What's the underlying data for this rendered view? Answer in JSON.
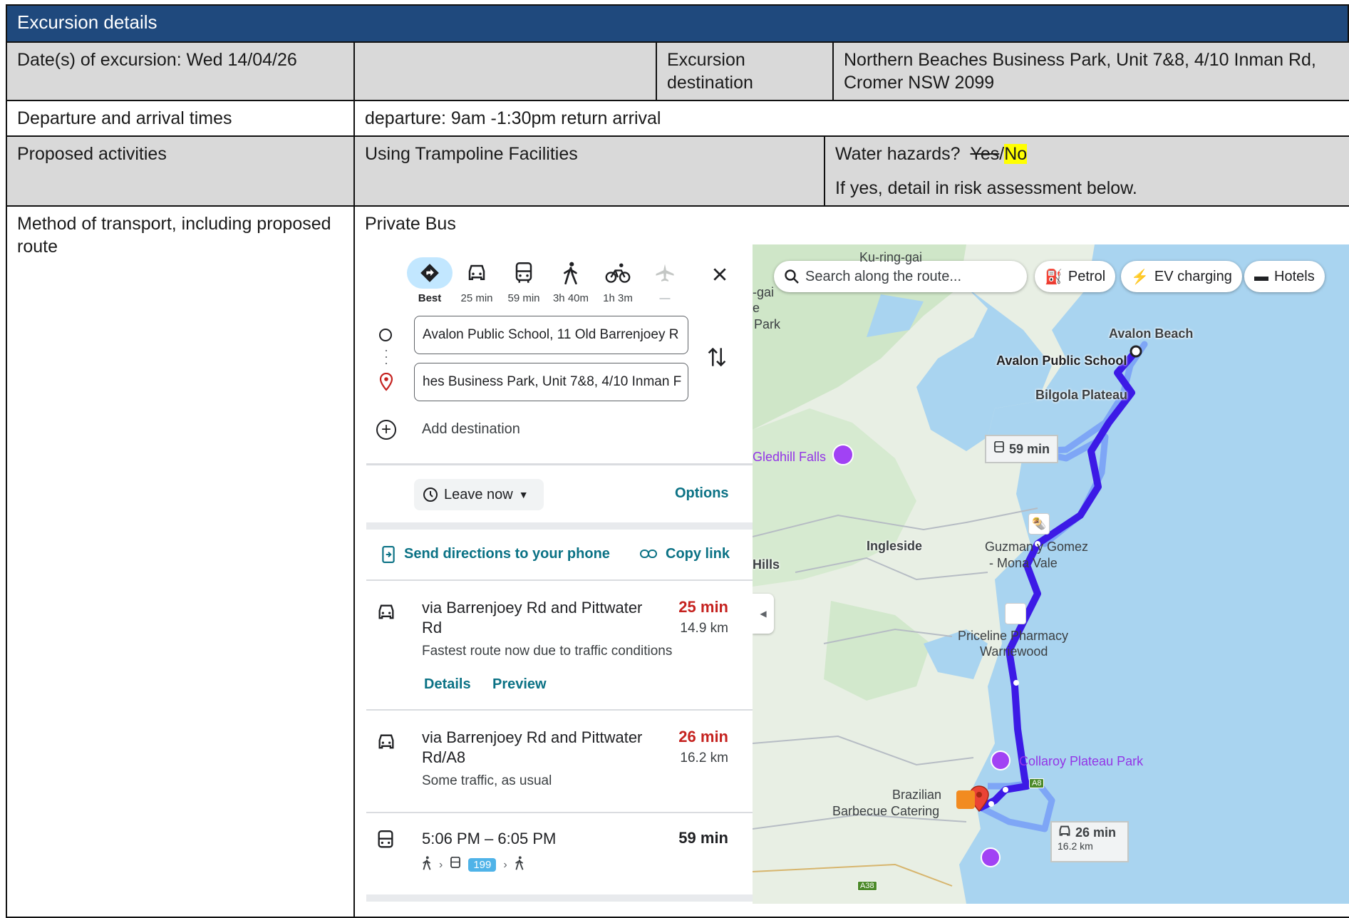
{
  "header": {
    "title": "Excursion details"
  },
  "rows": {
    "dates": {
      "label": "Date(s) of excursion: Wed 14/04/26",
      "dest_label": "Excursion destination",
      "dest_value": "Northern Beaches Business Park, Unit 7&8, 4/10 Inman Rd, Cromer NSW 2099"
    },
    "times": {
      "label": "Departure and arrival times",
      "value": "departure: 9am -1:30pm return arrival"
    },
    "activities": {
      "label": "Proposed activities",
      "value": "Using Trampoline Facilities",
      "water_label": "Water hazards?",
      "water_yes": "Yes",
      "water_sep": "/",
      "water_no": "No",
      "water_note": "If yes, detail in risk assessment below."
    },
    "transport": {
      "label": "Method of transport, including proposed route",
      "value": "Private Bus"
    }
  },
  "maps": {
    "modes": [
      {
        "icon": "directions-icon",
        "label": "Best",
        "active": true
      },
      {
        "icon": "car-icon",
        "label": "25 min"
      },
      {
        "icon": "bus-icon",
        "label": "59 min"
      },
      {
        "icon": "walk-icon",
        "label": "3h 40m"
      },
      {
        "icon": "bike-icon",
        "label": "1h 3m"
      },
      {
        "icon": "flight-icon",
        "label": "—"
      }
    ],
    "origin": "Avalon Public School, 11 Old Barrenjoey R",
    "destination": "hes Business Park, Unit 7&8, 4/10 Inman F",
    "add_destination": "Add destination",
    "leave_now": "Leave now",
    "options": "Options",
    "send_directions": "Send directions to your phone",
    "copy_link": "Copy link",
    "routes": [
      {
        "title": "via Barrenjoey Rd and Pittwater Rd",
        "time": "25 min",
        "km": "14.9 km",
        "note": "Fastest route now due to traffic conditions",
        "details": "Details",
        "preview": "Preview",
        "time_color": "#c5221f"
      },
      {
        "title": "via Barrenjoey Rd and Pittwater Rd/A8",
        "time": "26 min",
        "km": "16.2 km",
        "note": "Some traffic, as usual",
        "time_color": "#c5221f"
      },
      {
        "title": "5:06 PM – 6:05 PM",
        "time": "59 min",
        "bus_number": "199",
        "time_color": "#202124"
      }
    ],
    "map": {
      "search_placeholder": "Search along the route...",
      "chips": [
        "Petrol",
        "EV charging",
        "Hotels"
      ],
      "labels": {
        "kuringgai": "Ku-ring-gai",
        "gai": "-gai",
        "e": "e",
        "park": "Park",
        "avalon_beach": "Avalon Beach",
        "avalon_school": "Avalon Public School",
        "bilgola": "Bilgola Plateau",
        "gledhill": "Gledhill Falls",
        "ingleside": "Ingleside",
        "hills": "Hills",
        "guzman1": "Guzman y Gomez",
        "guzman2": "- Mona Vale",
        "priceline1": "Priceline Pharmacy",
        "priceline2": "Warriewood",
        "collaroy": "Collaroy Plateau Park",
        "brazilian1": "Brazilian",
        "brazilian2": "Barbecue Catering",
        "bus_time": "59 min",
        "car_time": "26 min",
        "car_km": "16.2 km",
        "a8": "A8",
        "a38": "A38"
      }
    }
  }
}
